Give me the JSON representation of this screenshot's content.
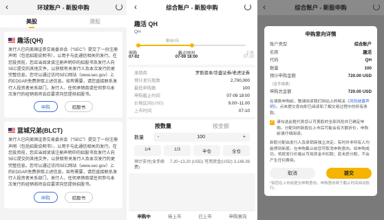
{
  "p1": {
    "title": "环球账户 - 新股申购",
    "tabs": [
      "美股",
      "港股"
    ],
    "cards": [
      {
        "name": "趣活(QH)",
        "desc": "发行人已向美国证券交易委员会（“SEC”）提交了一份注册声明（包括招股说明书），以用于与此通信相关的发行。在您投资前，您应当阅读该注册声明中的招股书及发行人向SEC提交的其他文件，以获取有关发行人及本次发行的更完整信息。您可以通过访问SEC网站（www.sec.gov）上的EDGAR免费获取上述信息。如有需要，请您直接联系发行人投资者关系部门，发行人、任何承销商或任何参与本次发行的经销商将会应要求向您提供招股书。",
        "btn1": "申购",
        "btn2": "招股书"
      },
      {
        "name": "蓝城兄弟(BLCT)",
        "desc": "发行人已向美国证券交易委员会（“SEC”）提交了一份注册声明（包括招股说明书），以用于与此通信相关的发行。在您投资前，您应当阅读该注册声明中的招股书及发行人向SEC提交的其他文件，以获取有关发行人及本次发行的更完整信息。您可以通过访问SEC网站（www.sec.gov）上的EDGAR免费获取上述信息。如有需要，请您直接联系发行人投资者关系部门，发行人、任何承销商或任何参与本次发行的经销商将会应要求向您提供招股书。",
        "btn1": "申购",
        "btn2": "招股书"
      }
    ]
  },
  "p2": {
    "title": "综合账户 - 新股申购",
    "stock_name": "趣活 QH",
    "stock_code": "QH",
    "timeline": {
      "countdown": "剩余0天",
      "steps": [
        {
          "label": "申购",
          "date": "07-02"
        },
        {
          "label": "截止时间",
          "date": "07-09 18:00"
        },
        {
          "label": "上市",
          "date": "07-10"
        }
      ],
      "progress": 0.5
    },
    "info": [
      {
        "k": "承销商",
        "v": "罗斯资本/华盛证券/老虎证券"
      },
      {
        "k": "预计发行股数",
        "v": "2,700,000"
      },
      {
        "k": "最低申购数",
        "v": "100"
      },
      {
        "k": "申购截止时间",
        "v": "07-09 18:00"
      },
      {
        "k": "价格区间(USD)",
        "v": "9.00~11.00"
      },
      {
        "k": "上市时间",
        "v": "07-10"
      }
    ],
    "order_tabs": [
      "按数量",
      "按金额"
    ],
    "qty_label": "数量",
    "qty_minus": "-",
    "qty_value": "100",
    "qty_plus": "+",
    "chips": [
      "1/4",
      "1/3",
      "半仓",
      "全仓"
    ],
    "est_label": "预计支付(含手续费)",
    "est_range": "7.20~13.20 (USD)",
    "avail_label": "可用资金(USD)",
    "avail_value": "3,148.39",
    "nav": [
      "申购中",
      "待上市",
      "已上市",
      "申购意向"
    ]
  },
  "p3": {
    "title": "综合账户 - 新股申购",
    "dlg_title": "申购意向详情",
    "rows": [
      {
        "k": "账户类型",
        "v": "综合账户"
      },
      {
        "k": "名称",
        "v": "趣活"
      },
      {
        "k": "代码",
        "v": "QH"
      },
      {
        "k": "数量",
        "v": "100"
      }
    ],
    "est_k": "预计申购金额",
    "est_sub": "（含手续费）",
    "est_v": "720.00 USD",
    "margin_k": "申购总金额",
    "margin_v": "720.00 USD",
    "note1_a": "在请款申购前，敬请阅读我们网站上的相关",
    "note1_link": "《风险披露声明》",
    "note1_b": "。点击提交意向即已阅读和了解交易过程中的所有条款。",
    "check_text": "请勾选此框代表您认可美股的全部风险并已确定申购。分配到的新股在上市后可能会有大额折价，申购前请仔细阅读。",
    "note2": "新股分配由发行人及承销商独立决定，有时并非所有人均能得到新股，在申购截止前您可取消申购意向。如申购成功，将按发行价格从可用资金中扣款；若未获分配，不会产生任何费用。",
    "cancel": "取消",
    "submit": "提交",
    "foot": "*如您在上市前提交申购意向，申购意向将于截止时间自动执行。"
  }
}
